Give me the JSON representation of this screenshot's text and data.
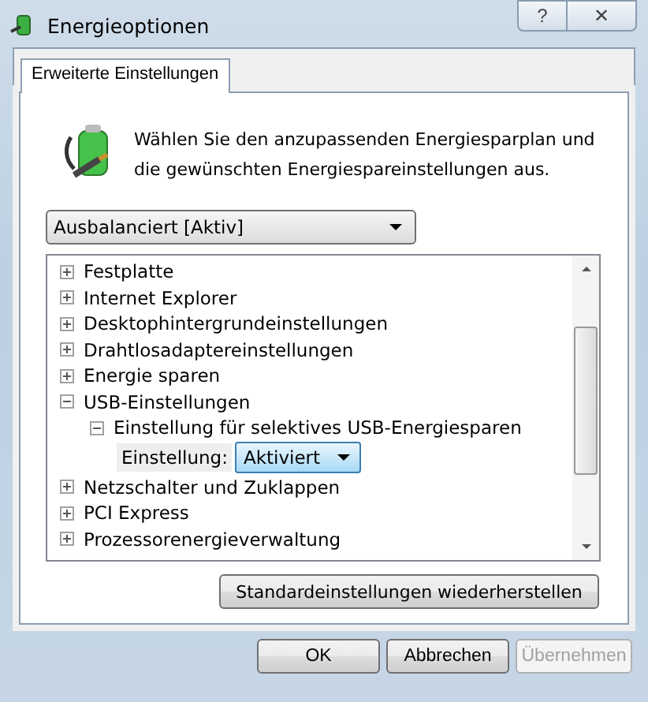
{
  "window": {
    "title": "Energieoptionen",
    "help_glyph": "?",
    "close_glyph": "✕"
  },
  "tabs": [
    {
      "label": "Erweiterte Einstellungen",
      "selected": true
    }
  ],
  "intro": "Wählen Sie den anzupassenden Energiesparplan und die gewünschten Energiespareinstellungen aus.",
  "plan_dropdown": {
    "value": "Ausbalanciert [Aktiv]"
  },
  "tree": [
    {
      "kind": "node",
      "label": "Festplatte",
      "expanded": false
    },
    {
      "kind": "node",
      "label": "Internet Explorer",
      "expanded": false
    },
    {
      "kind": "node",
      "label": "Desktophintergrundeinstellungen",
      "expanded": false
    },
    {
      "kind": "node",
      "label": "Drahtlosadaptereinstellungen",
      "expanded": false
    },
    {
      "kind": "node",
      "label": "Energie sparen",
      "expanded": false
    },
    {
      "kind": "node",
      "label": "USB-Einstellungen",
      "expanded": true,
      "children": [
        {
          "kind": "node",
          "label": "Einstellung für selektives USB-Energiesparen",
          "expanded": true,
          "children": [
            {
              "kind": "setting",
              "label": "Einstellung:",
              "value": "Aktiviert"
            }
          ]
        }
      ]
    },
    {
      "kind": "node",
      "label": "Netzschalter und Zuklappen",
      "expanded": false
    },
    {
      "kind": "node",
      "label": "PCI Express",
      "expanded": false
    },
    {
      "kind": "node",
      "label": "Prozessorenergieverwaltung",
      "expanded": false
    }
  ],
  "restore_button": "Standardeinstellungen wiederherstellen",
  "buttons": [
    {
      "label": "OK",
      "disabled": false
    },
    {
      "label": "Abbrechen",
      "disabled": false
    },
    {
      "label": "Übernehmen",
      "disabled": true
    }
  ]
}
